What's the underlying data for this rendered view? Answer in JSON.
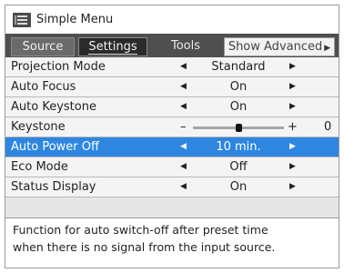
{
  "window": {
    "title": "Simple Menu",
    "icon": "menu-list-icon"
  },
  "tabs": [
    {
      "label": "Source",
      "state": "inactive"
    },
    {
      "label": "Settings",
      "state": "active"
    },
    {
      "label": "Tools",
      "state": "inactive"
    },
    {
      "label": "Show Advanced",
      "arrow_icon": "right-triangle-icon"
    }
  ],
  "settings": [
    {
      "label": "Projection Mode",
      "value": "Standard"
    },
    {
      "label": "Auto Focus",
      "value": "On"
    },
    {
      "label": "Auto Keystone",
      "value": "On"
    },
    {
      "label": "Keystone",
      "type": "slider",
      "minus": "–",
      "plus": "+",
      "value": "0",
      "level_fraction": 0.5
    },
    {
      "label": "Auto Power Off",
      "value": "10 min.",
      "selected": true
    },
    {
      "label": "Eco Mode",
      "value": "Off"
    },
    {
      "label": "Status Display",
      "value": "On"
    }
  ],
  "arrows": {
    "left": "◀",
    "right": "▶"
  },
  "help": {
    "line1": "Function for auto switch-off after preset time",
    "line2": "when there is no signal from the input source."
  },
  "colors": {
    "selection": "#2e86e0",
    "tabbar": "#4f4f4f",
    "active_tab": "#2b2b2b"
  }
}
